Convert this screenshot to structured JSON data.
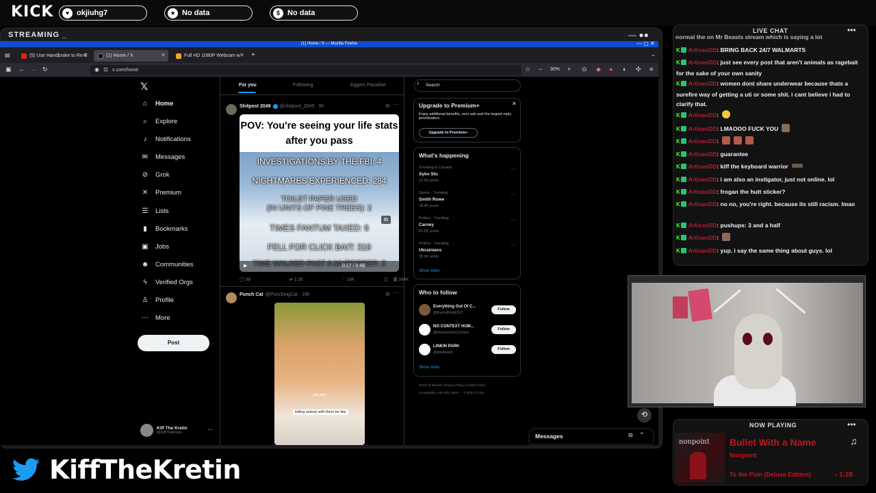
{
  "overlay": {
    "brand": "KICK",
    "pills": [
      {
        "icon": "heart-icon",
        "glyph": "♥",
        "label": "okjiuhg7"
      },
      {
        "icon": "star-icon",
        "glyph": "★",
        "label": "No data"
      },
      {
        "icon": "dollar-icon",
        "glyph": "$",
        "label": "No data"
      }
    ],
    "stream_label": "STREAMING _",
    "twitter_name": "KiffTheKretin"
  },
  "browser": {
    "window_title": "(1) Home / X — Mozilla Firefox",
    "tabs": [
      {
        "label": "(5) Use Handbrake to Re-E",
        "active": false
      },
      {
        "label": "(1) Home / X",
        "active": true
      },
      {
        "label": "Full HD 1080P Webcam w",
        "active": false
      }
    ],
    "url": "x.com/home",
    "zoom": "90%"
  },
  "x": {
    "nav": [
      {
        "icon": "home-icon",
        "glyph": "⌂",
        "label": "Home"
      },
      {
        "icon": "explore-icon",
        "glyph": "⌕",
        "label": "Explore"
      },
      {
        "icon": "bell-icon",
        "glyph": "♪",
        "label": "Notifications"
      },
      {
        "icon": "mail-icon",
        "glyph": "✉",
        "label": "Messages"
      },
      {
        "icon": "grok-icon",
        "glyph": "⊘",
        "label": "Grok"
      },
      {
        "icon": "x-premium-icon",
        "glyph": "✕",
        "label": "Premium"
      },
      {
        "icon": "list-icon",
        "glyph": "☰",
        "label": "Lists"
      },
      {
        "icon": "bookmark-icon",
        "glyph": "▮",
        "label": "Bookmarks"
      },
      {
        "icon": "briefcase-icon",
        "glyph": "▣",
        "label": "Jobs"
      },
      {
        "icon": "communities-icon",
        "glyph": "☻",
        "label": "Communities"
      },
      {
        "icon": "lightning-icon",
        "glyph": "ϟ",
        "label": "Verified Orgs"
      },
      {
        "icon": "profile-icon",
        "glyph": "♙",
        "label": "Profile"
      },
      {
        "icon": "more-icon",
        "glyph": "⋯",
        "label": "More"
      }
    ],
    "post_button": "Post",
    "account": {
      "name": "Kiff The Kretin",
      "handle": "@KiffTheKretin"
    },
    "feed_tabs": [
      "For you",
      "Following",
      "Eggers Paradise"
    ],
    "tweet1": {
      "name": "Shitpost 2049",
      "handle": "@shitpost_2049 · 9h",
      "meme_title": "POV: You're seeing your life stats after you pass",
      "meme_lines": [
        "INVESTIGATIONS BY THE FBI: 4",
        "NIGHTMARES EXPERIENCED: 284",
        "TOILET PAPER USED",
        "(IN UNITS OF PINE TREES): 2",
        "TIMES FANTUM TAXED: 6",
        "FELL FOR CLICK BAIT: 318",
        "TIME WALKED PAST A MURDERER: 2"
      ],
      "video_time": "0:17 / 0:48",
      "stats": {
        "replies": "88",
        "reposts": "1.2K",
        "likes": "16K",
        "views": "394K"
      }
    },
    "tweet2": {
      "name": "Punch Cat",
      "handle": "@PunchingCat · 19h",
      "caption1": "yes why",
      "caption2": "falling asleep with them be like"
    },
    "search_placeholder": "Search",
    "premium": {
      "title": "Upgrade to Premium+",
      "text": "Enjoy additional benefits, zero ads and the largest reply prioritization.",
      "button": "Upgrade to Premium+"
    },
    "happening": {
      "title": "What's happening",
      "trends": [
        {
          "context": "Trending in Canada",
          "name": "Syko Stu",
          "posts": "22.9K posts"
        },
        {
          "context": "Sports · Trending",
          "name": "Smith Rowe",
          "posts": "18.4K posts"
        },
        {
          "context": "Politics · Trending",
          "name": "Carney",
          "posts": "81.5K posts"
        },
        {
          "context": "Politics · Trending",
          "name": "Ukrainians",
          "posts": "35.9K posts"
        }
      ],
      "show_more": "Show more"
    },
    "who_to_follow": {
      "title": "Who to follow",
      "accounts": [
        {
          "name": "Everything Out Of C...",
          "handle": "@EverythingOOC"
        },
        {
          "name": "NO CONTEXT HUM...",
          "handle": "@HumansNoContext"
        },
        {
          "name": "LINKIN PARK",
          "handle": "@linkinpark"
        }
      ],
      "follow_label": "Follow",
      "show_more": "Show more"
    },
    "footer1": "Terms of Service | Privacy Policy | Cookie Policy |",
    "footer2": "Accessibility | Ads info | More ··· © 2025 X Corp.",
    "messages_label": "Messages"
  },
  "chat": {
    "title": "LIVE CHAT",
    "username": "ArtisanDD",
    "messages": [
      {
        "text": ": BRING BACK 24/7 WALMARTS"
      },
      {
        "text": ": just see every post that aren't animals as ragebait for the sake of your own sanity"
      },
      {
        "text": ": women dont share underwear because thats a surefire way of getting a uti or some shit. i cant believe i had to clarify that."
      },
      {
        "text": ":",
        "emote": "grin"
      },
      {
        "text": ": LMAOOO FUCK YOU",
        "emote": "face"
      },
      {
        "text": ":",
        "emote": "triple"
      },
      {
        "text": ": guarantee"
      },
      {
        "text": ": kiff the keyboard warrior",
        "emote": "keyboard"
      },
      {
        "text": ": i am also an instigator, just not online. lol"
      },
      {
        "text": ": frogan the hutt sticker?"
      },
      {
        "text": ": no no, you're right. because its still racism. lmao"
      },
      {
        "text": ": pushups: 3 and a half"
      },
      {
        "text": ":",
        "emote": "face"
      },
      {
        "text": ": yup. i say the same thing about guys. lol"
      }
    ],
    "partial_top": "normal the on Mr Beasts stream which is saying a lot"
  },
  "now_playing": {
    "title": "NOW PLAYING",
    "song": "Bullet With a Name",
    "artist": "Nonpoint",
    "album": "To the Pain (Deluxe Edition)",
    "time": "- 1:28",
    "album_text": "nonpoint"
  },
  "colors": {
    "accent_kick": "#53fc18",
    "x_blue": "#1d9bf0",
    "song_red": "#c3141c",
    "chat_user": "#c5162d"
  }
}
